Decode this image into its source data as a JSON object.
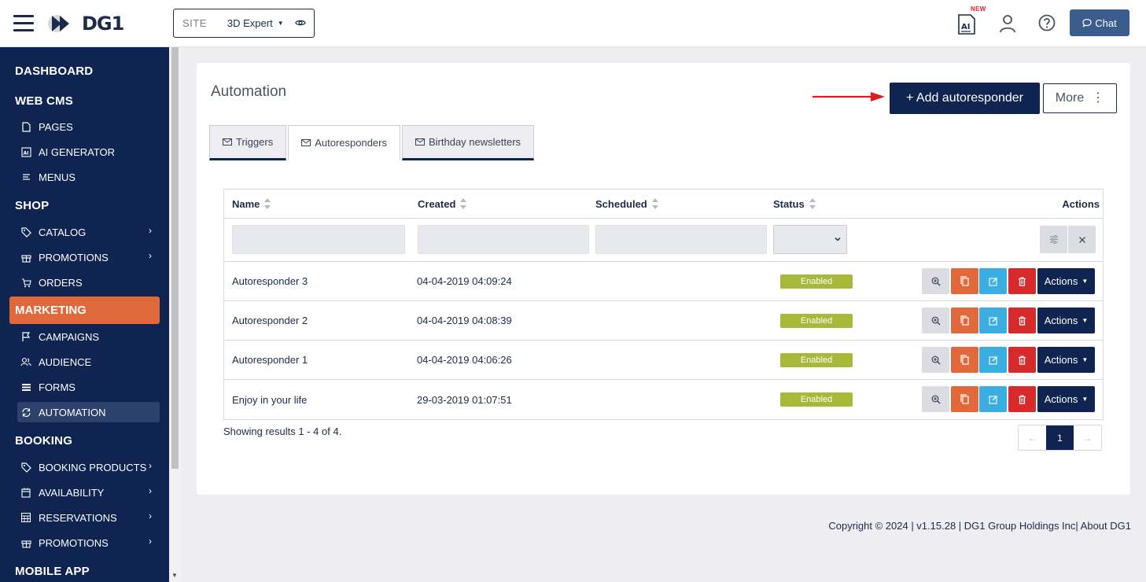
{
  "header": {
    "brand": "DG1",
    "site_label": "SITE",
    "site_value": "3D Expert",
    "ai_badge": "NEW",
    "chat_label": "Chat"
  },
  "sidebar": {
    "sections": [
      {
        "label": "DASHBOARD"
      },
      {
        "label": "WEB CMS"
      },
      {
        "label": "SHOP"
      },
      {
        "label": "MARKETING"
      },
      {
        "label": "BOOKING"
      },
      {
        "label": "MOBILE APP"
      }
    ],
    "items": [
      {
        "label": "PAGES",
        "icon": "page-icon"
      },
      {
        "label": "AI GENERATOR",
        "icon": "ai-icon"
      },
      {
        "label": "MENUS",
        "icon": "menu-icon"
      },
      {
        "label": "CATALOG",
        "icon": "tag-icon"
      },
      {
        "label": "PROMOTIONS",
        "icon": "gift-icon"
      },
      {
        "label": "ORDERS",
        "icon": "cart-icon"
      },
      {
        "label": "CAMPAIGNS",
        "icon": "flag-icon"
      },
      {
        "label": "AUDIENCE",
        "icon": "users-icon"
      },
      {
        "label": "FORMS",
        "icon": "list-icon"
      },
      {
        "label": "AUTOMATION",
        "icon": "refresh-icon"
      },
      {
        "label": "BOOKING PRODUCTS",
        "icon": "tag-icon"
      },
      {
        "label": "AVAILABILITY",
        "icon": "calendar-icon"
      },
      {
        "label": "RESERVATIONS",
        "icon": "grid-calendar-icon"
      },
      {
        "label": "PROMOTIONS",
        "icon": "gift-icon"
      }
    ]
  },
  "main": {
    "title": "Automation",
    "add_button": "+ Add autoresponder",
    "more_button": "More",
    "tabs": [
      {
        "label": "Triggers"
      },
      {
        "label": "Autoresponders"
      },
      {
        "label": "Birthday newsletters"
      }
    ],
    "table": {
      "columns": [
        "Name",
        "Created",
        "Scheduled",
        "Status",
        "Actions"
      ],
      "rows": [
        {
          "name": "Autoresponder 3",
          "created": "04-04-2019 04:09:24",
          "scheduled": "",
          "status": "Enabled",
          "actions": "Actions"
        },
        {
          "name": "Autoresponder 2",
          "created": "04-04-2019 04:08:39",
          "scheduled": "",
          "status": "Enabled",
          "actions": "Actions"
        },
        {
          "name": "Autoresponder 1",
          "created": "04-04-2019 04:06:26",
          "scheduled": "",
          "status": "Enabled",
          "actions": "Actions"
        },
        {
          "name": "Enjoy in your life",
          "created": "29-03-2019 01:07:51",
          "scheduled": "",
          "status": "Enabled",
          "actions": "Actions"
        }
      ]
    },
    "showing": "Showing results 1 - 4 of 4.",
    "pager": {
      "prev": "←",
      "current": "1",
      "next": "→"
    }
  },
  "footer": {
    "text": "Copyright © 2024 | v1.15.28 | DG1 Group Holdings Inc| About DG1"
  },
  "colors": {
    "navy": "#0f2451",
    "accent_orange": "#e0683a",
    "status_green": "#a8b838",
    "edit_blue": "#3aaee0",
    "delete_red": "#d72b2b",
    "chat_blue": "#3a5d8e"
  }
}
